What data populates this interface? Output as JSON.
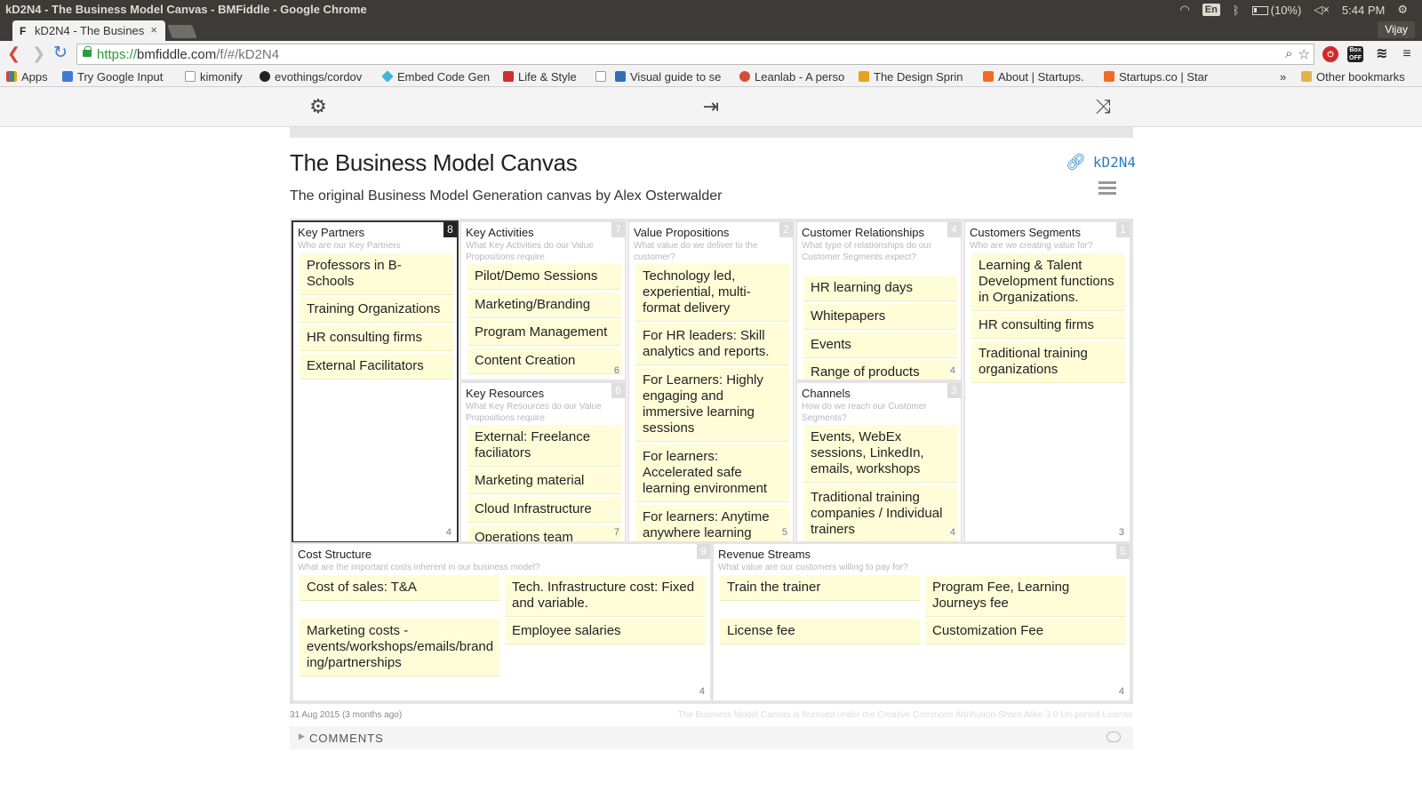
{
  "os": {
    "window_title": "kD2N4 - The Business Model Canvas - BMFiddle - Google Chrome",
    "battery": "(10%)",
    "lang": "En",
    "clock": "5:44 PM"
  },
  "browser": {
    "tab_title": "kD2N4 - The Busines",
    "tab_favicon": "F",
    "tab_close": "×",
    "user": "Vijay",
    "url_protocol": "https://",
    "url_host": "bmfiddle.com",
    "url_path": "/f/#/kD2N4",
    "extension_label": "Box OFF",
    "bookmarks": [
      {
        "label": "Apps",
        "color": "#d9453d"
      },
      {
        "label": "Try Google Input",
        "color": "#3f79d3"
      },
      {
        "label": "kimonify",
        "color": "#ffffff"
      },
      {
        "label": "evothings/cordov",
        "color": "#222222"
      },
      {
        "label": "Embed Code Gen",
        "color": "#3fb8d3"
      },
      {
        "label": "Life & Style",
        "color": "#d22d2d"
      },
      {
        "label": "",
        "color": "#ffffff"
      },
      {
        "label": "Visual guide to se",
        "color": "#2f6fb8"
      },
      {
        "label": "Leanlab - A perso",
        "color": "#d44d3a"
      },
      {
        "label": "The Design Sprin",
        "color": "#e8a31d"
      },
      {
        "label": "About | Startups.",
        "color": "#f26b21"
      },
      {
        "label": "Startups.co | Star",
        "color": "#f26b21"
      }
    ],
    "bookmarks_more": "»",
    "other_bookmarks": "Other bookmarks"
  },
  "canvas": {
    "title": "The Business Model Canvas",
    "subtitle": "The original Business Model Generation canvas by Alex Osterwalder",
    "id_link": "kD2N4",
    "date": "31 Aug 2015 (3 months ago)",
    "license": "The Business Model Canvas is licensed under the Creative Commons Attribution-Share Alike 3.0 Un-ported License",
    "comments_label": "COMMENTS",
    "blocks": {
      "key_partners": {
        "title": "Key Partners",
        "question": "Who are our Key Partners",
        "number": "8",
        "count": "4",
        "notes": [
          "Professors in B-Schools",
          "Training Organizations",
          "HR consulting firms",
          "External Facilitators"
        ]
      },
      "key_activities": {
        "title": "Key Activities",
        "question": "What Key Activities do our Value Propositions require",
        "number": "7",
        "count": "6",
        "notes": [
          "Pilot/Demo Sessions",
          "Marketing/Branding",
          "Program Management",
          "Content Creation"
        ]
      },
      "key_resources": {
        "title": "Key Resources",
        "question": "What Key Resources do our Value Propositions require",
        "number": "6",
        "count": "7",
        "notes": [
          "External: Freelance faciliators",
          "Marketing material",
          "Cloud Infrastructure",
          "Operations team"
        ]
      },
      "value_propositions": {
        "title": "Value Propositions",
        "question": "What value do we deliver to the customer?",
        "number": "2",
        "count": "5",
        "notes": [
          "Technology led, experiential, multi-format delivery",
          "For HR leaders: Skill analytics and reports.",
          "For Learners: Highly engaging and immersive learning sessions",
          "For learners: Accelerated safe learning environment",
          "For learners: Anytime anywhere learning"
        ]
      },
      "customer_relationships": {
        "title": "Customer Relationships",
        "question": "What type of relationships do our Customer Segments expect?",
        "number": "4",
        "count": "4",
        "notes": [
          "HR learning days",
          "Whitepapers",
          "Events",
          "Range of products"
        ]
      },
      "channels": {
        "title": "Channels",
        "question": "How do we reach our Customer Segments?",
        "number": "3",
        "count": "4",
        "notes": [
          "Events, WebEx sessions, LinkedIn, emails, workshops",
          "Traditional training companies / Individual trainers"
        ]
      },
      "customer_segments": {
        "title": "Customers Segments",
        "question": "Who are we creating value for?",
        "number": "1",
        "count": "3",
        "notes": [
          "Learning & Talent Development functions in Organizations.",
          "HR consulting firms",
          "Traditional training organizations"
        ]
      },
      "cost_structure": {
        "title": "Cost Structure",
        "question": "What are the important costs inherent in our business model?",
        "number": "9",
        "count": "4",
        "notes": [
          "Cost of sales: T&A",
          "Tech. Infrastructure cost: Fixed and variable.",
          "Marketing costs - events/workshops/emails/brand ing/partnerships",
          "Employee salaries"
        ]
      },
      "revenue_streams": {
        "title": "Revenue Streams",
        "question": "What value are our customers willing to pay for?",
        "number": "5",
        "count": "4",
        "notes": [
          "Train the trainer",
          "Program Fee, Learning Journeys fee",
          "License fee",
          "Customization Fee"
        ]
      }
    }
  }
}
